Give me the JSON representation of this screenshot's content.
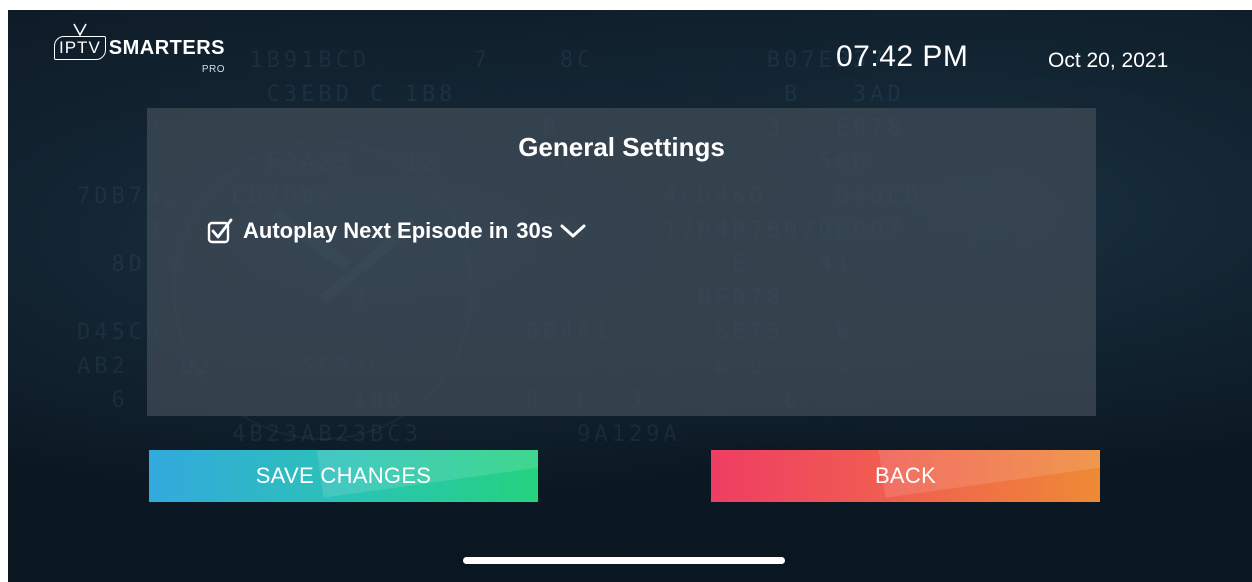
{
  "app": {
    "logo_main": "IPTV",
    "logo_secondary": "SMARTERS",
    "logo_sub": "PRO"
  },
  "header": {
    "time": "07:42 PM",
    "date": "Oct 20, 2021"
  },
  "panel": {
    "title": "General Settings",
    "autoplay": {
      "checked": true,
      "label": "Autoplay Next Episode in",
      "value": "30s",
      "checkbox_icon": "checkbox-checked-icon",
      "dropdown_icon": "chevron-down-icon"
    }
  },
  "buttons": {
    "save_label": "SAVE CHANGES",
    "back_label": "BACK"
  },
  "colors": {
    "save_gradient": [
      "#33a9de",
      "#25d27e"
    ],
    "back_gradient": [
      "#ef3d64",
      "#ee8a35"
    ],
    "panel_bg": "#3e4a56",
    "text": "#ffffff"
  }
}
